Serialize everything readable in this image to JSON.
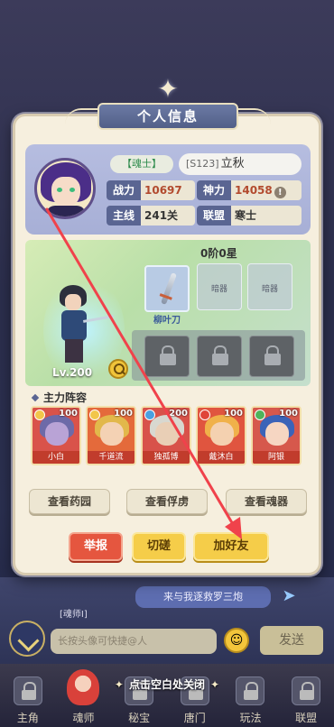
{
  "background": {
    "chat_bubble": "来与我逐救罗三炮",
    "soul_tag": "[魂师Ⅰ]",
    "chat_input_placeholder": "长按头像可快捷@人",
    "send_label": "发送"
  },
  "bottom_nav": [
    {
      "label": "主角"
    },
    {
      "label": "魂师"
    },
    {
      "label": "秘宝"
    },
    {
      "label": "唐门"
    },
    {
      "label": "玩法"
    },
    {
      "label": "联盟"
    }
  ],
  "close_hint": "点击空白处关闭",
  "panel": {
    "title": "个人信息",
    "soul_tag": "【魂士】",
    "server": "[S123]",
    "player_name": "立秋",
    "stats": {
      "power_label": "战力",
      "power_value": "10697",
      "divine_label": "神力",
      "divine_value": "14058",
      "main_label": "主线",
      "main_value": "241关",
      "alliance_label": "联盟",
      "alliance_value": "寒士"
    },
    "hero_level": "Lv.200",
    "rank": "0阶0星",
    "equipment": [
      {
        "name": "柳叶刀",
        "filled": true
      },
      {
        "name": "暗器",
        "filled": false
      },
      {
        "name": "暗器",
        "filled": false
      }
    ],
    "team_title": "主力阵容",
    "team": [
      {
        "name": "小白",
        "level": "100",
        "color": "#6d6aa8"
      },
      {
        "name": "千道流",
        "level": "100",
        "color": "#e2b84b"
      },
      {
        "name": "独孤博",
        "level": "200",
        "color": "#d8d8d0"
      },
      {
        "name": "戴沐白",
        "level": "100",
        "color": "#f0b14a"
      },
      {
        "name": "阿银",
        "level": "100",
        "color": "#3b63b8"
      }
    ],
    "buttons": {
      "view_garden": "查看药园",
      "view_captive": "查看俘虏",
      "view_soul_device": "查看魂器",
      "report": "举报",
      "spar": "切磋",
      "add_friend": "加好友"
    }
  },
  "colors": {
    "panel_bg": "#f6efde",
    "accent": "#5a6592",
    "arrow": "#f0424b"
  }
}
